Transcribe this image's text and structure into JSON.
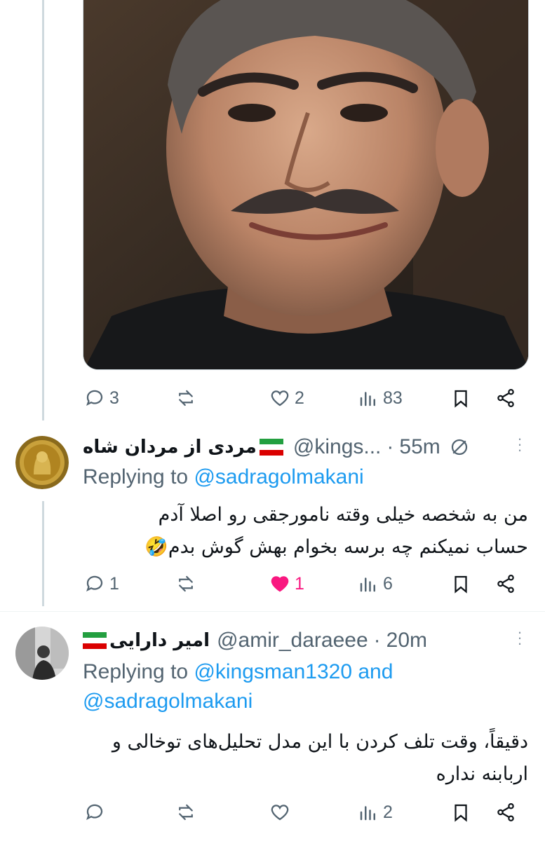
{
  "post": {
    "stats": {
      "replies": "3",
      "retweets": "",
      "likes": "2",
      "views": "83"
    }
  },
  "replies": [
    {
      "name": "مردی از مردان شاه",
      "handle": "@kings...",
      "time": "55m",
      "replying_prefix": "Replying to ",
      "replying_to": "@sadragolmakani",
      "text_line1": "من به شخصه خیلی وقته نامورجقی رو اصلا آدم",
      "text_line2": "حساب نمیکنم  چه برسه بخوام بهش گوش بدم🤣",
      "stats": {
        "replies": "1",
        "retweets": "",
        "likes": "1",
        "views": "6"
      },
      "liked": true
    },
    {
      "name": "امیر دارایی",
      "handle": "@amir_daraeee",
      "time": "20m",
      "replying_prefix": "Replying to ",
      "replying_to_line1": "@kingsman1320 and",
      "replying_to_line2": "@sadragolmakani",
      "text_line1": "دقیقاً، وقت تلف کردن با این مدل تحلیل‌های توخالی و",
      "text_line2": "اربابنه نداره",
      "stats": {
        "replies": "",
        "retweets": "",
        "likes": "",
        "views": "2"
      },
      "liked": false
    }
  ],
  "colors": {
    "accent": "#1d9bf0",
    "like": "#f91880",
    "muted": "#536471",
    "flag_green": "#239f40",
    "flag_red": "#da0000"
  },
  "icons": [
    "reply-icon",
    "retweet-icon",
    "like-icon",
    "views-icon",
    "bookmark-icon",
    "share-icon",
    "muted-icon",
    "more-icon"
  ]
}
